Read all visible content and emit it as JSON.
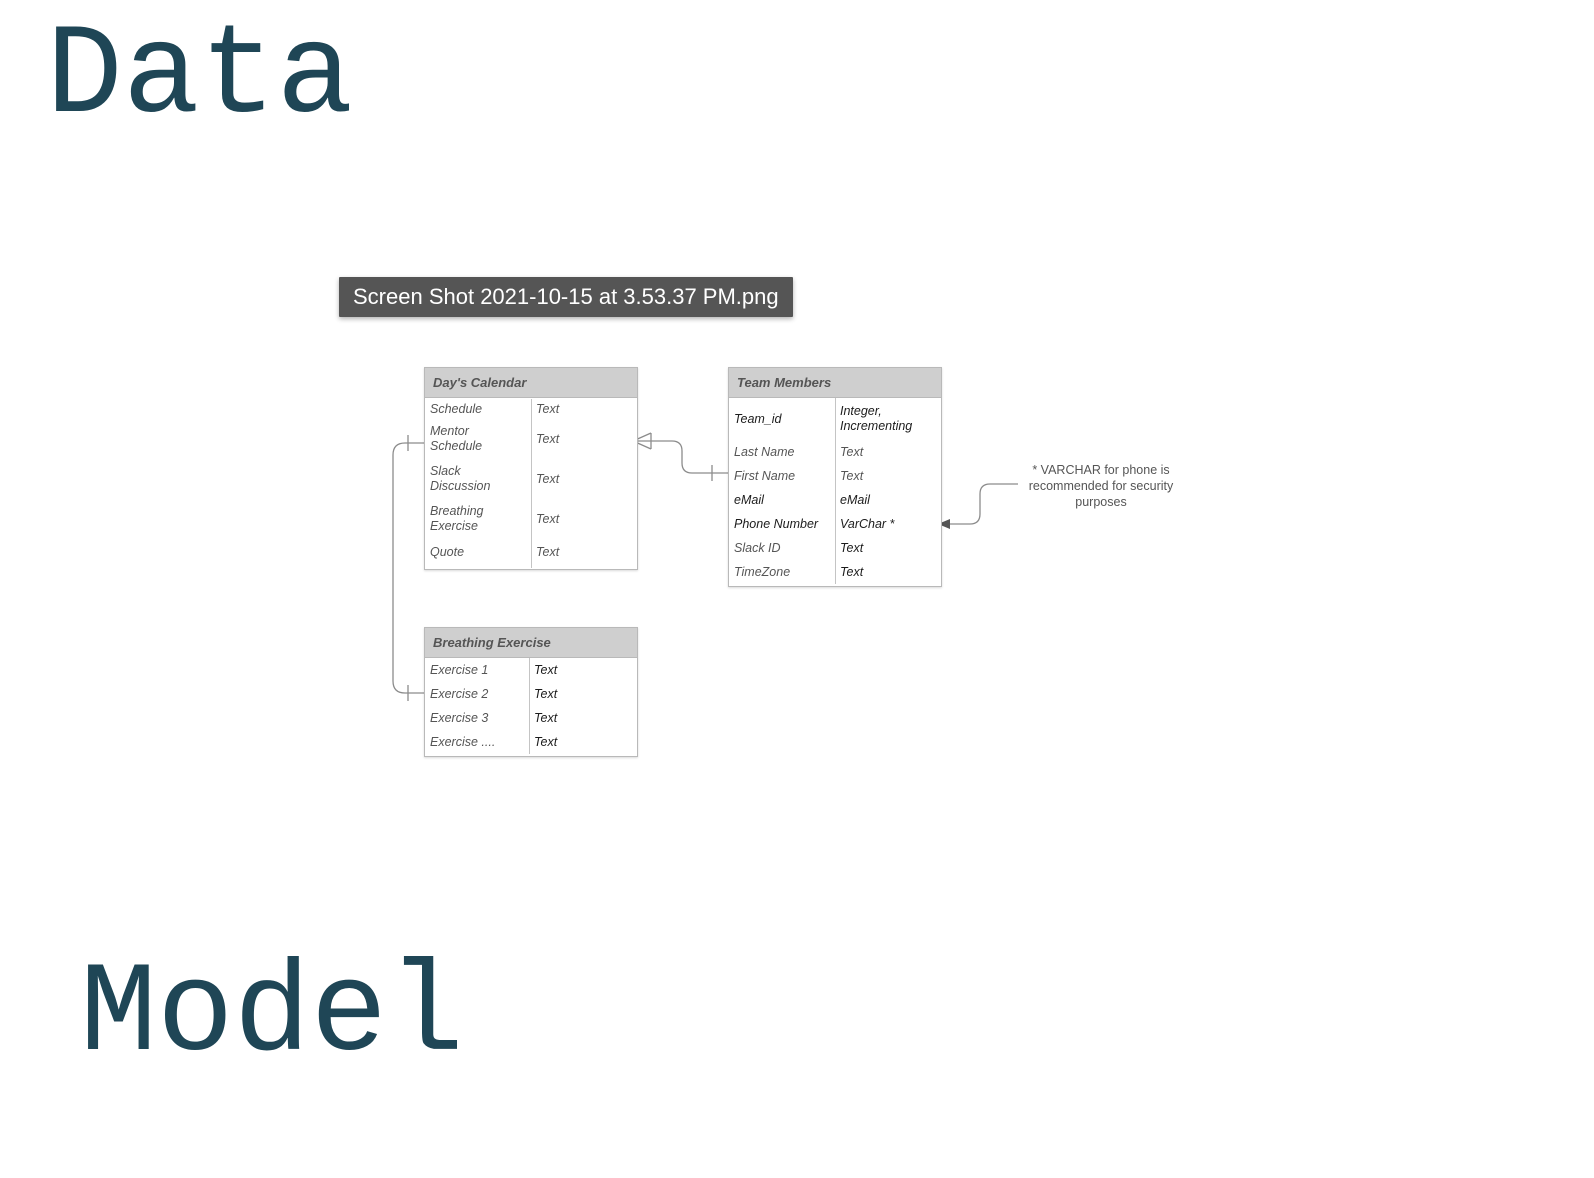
{
  "titles": {
    "top": "Data",
    "bottom": "Model"
  },
  "tooltip": {
    "filename": "Screen Shot 2021-10-15 at 3.53.37 PM.png"
  },
  "diagram": {
    "tables": {
      "days_calendar": {
        "title": "Day's Calendar",
        "rows": [
          {
            "field": "Schedule",
            "type": "Text"
          },
          {
            "field": "Mentor Schedule",
            "type": "Text"
          },
          {
            "field": "Slack Discussion",
            "type": "Text"
          },
          {
            "field": "Breathing Exercise",
            "type": "Text"
          },
          {
            "field": "Quote",
            "type": "Text"
          }
        ]
      },
      "team_members": {
        "title": "Team Members",
        "rows": [
          {
            "field": "Team_id",
            "type": "Integer, Incrementing"
          },
          {
            "field": "Last Name",
            "type": "Text"
          },
          {
            "field": "First Name",
            "type": "Text"
          },
          {
            "field": "eMail",
            "type": "eMail"
          },
          {
            "field": "Phone Number",
            "type": "VarChar *"
          },
          {
            "field": "Slack ID",
            "type": "Text"
          },
          {
            "field": "TimeZone",
            "type": "Text"
          }
        ]
      },
      "breathing_exercise": {
        "title": "Breathing Exercise",
        "rows": [
          {
            "field": "Exercise 1",
            "type": "Text"
          },
          {
            "field": "Exercise 2",
            "type": "Text"
          },
          {
            "field": "Exercise 3",
            "type": "Text"
          },
          {
            "field": "Exercise ....",
            "type": "Text"
          }
        ]
      }
    },
    "note": "* VARCHAR for phone is recommended for security purposes"
  },
  "colors": {
    "title": "#1f4656",
    "tooltip_bg": "#555555",
    "header_bg": "#cfcfcf"
  }
}
